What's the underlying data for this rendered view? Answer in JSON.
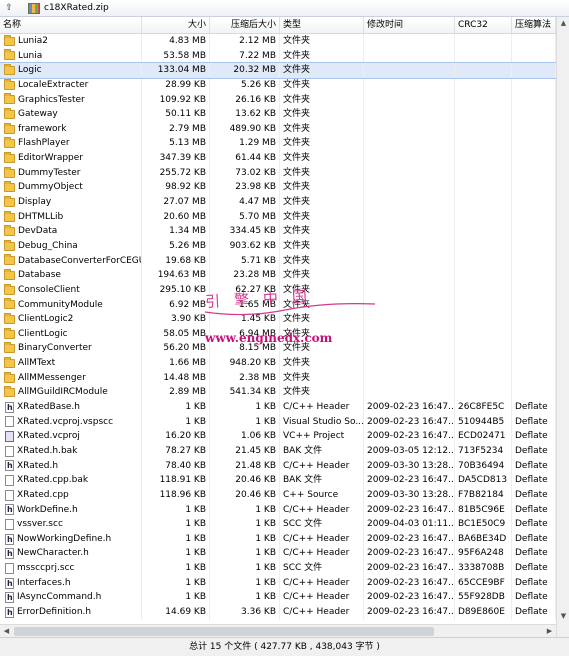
{
  "window": {
    "title": "c18XRated.zip"
  },
  "columns": [
    {
      "label": "名称",
      "w": 142
    },
    {
      "label": "大小",
      "w": 68,
      "align": "r"
    },
    {
      "label": "压缩后大小",
      "w": 70,
      "align": "r"
    },
    {
      "label": "类型",
      "w": 84
    },
    {
      "label": "修改时间",
      "w": 91
    },
    {
      "label": "CRC32",
      "w": 57
    },
    {
      "label": "压缩算法",
      "w": 44
    }
  ],
  "rows": [
    {
      "name": "Lunia2",
      "size": "4.83 MB",
      "packed": "2.12 MB",
      "type": "文件夹",
      "mtime": "",
      "crc": "",
      "method": "",
      "icon": "folder"
    },
    {
      "name": "Lunia",
      "size": "53.58 MB",
      "packed": "7.22 MB",
      "type": "文件夹",
      "mtime": "",
      "crc": "",
      "method": "",
      "icon": "folder"
    },
    {
      "name": "Logic",
      "size": "133.04 MB",
      "packed": "20.32 MB",
      "type": "文件夹",
      "mtime": "",
      "crc": "",
      "method": "",
      "icon": "folder",
      "selected": true
    },
    {
      "name": "LocaleExtracter",
      "size": "28.99 KB",
      "packed": "5.26 KB",
      "type": "文件夹",
      "mtime": "",
      "crc": "",
      "method": "",
      "icon": "folder"
    },
    {
      "name": "GraphicsTester",
      "size": "109.92 KB",
      "packed": "26.16 KB",
      "type": "文件夹",
      "mtime": "",
      "crc": "",
      "method": "",
      "icon": "folder"
    },
    {
      "name": "Gateway",
      "size": "50.11 KB",
      "packed": "13.62 KB",
      "type": "文件夹",
      "mtime": "",
      "crc": "",
      "method": "",
      "icon": "folder"
    },
    {
      "name": "framework",
      "size": "2.79 MB",
      "packed": "489.90 KB",
      "type": "文件夹",
      "mtime": "",
      "crc": "",
      "method": "",
      "icon": "folder"
    },
    {
      "name": "FlashPlayer",
      "size": "5.13 MB",
      "packed": "1.29 MB",
      "type": "文件夹",
      "mtime": "",
      "crc": "",
      "method": "",
      "icon": "folder"
    },
    {
      "name": "EditorWrapper",
      "size": "347.39 KB",
      "packed": "61.44 KB",
      "type": "文件夹",
      "mtime": "",
      "crc": "",
      "method": "",
      "icon": "folder"
    },
    {
      "name": "DummyTester",
      "size": "255.72 KB",
      "packed": "73.02 KB",
      "type": "文件夹",
      "mtime": "",
      "crc": "",
      "method": "",
      "icon": "folder"
    },
    {
      "name": "DummyObject",
      "size": "98.92 KB",
      "packed": "23.98 KB",
      "type": "文件夹",
      "mtime": "",
      "crc": "",
      "method": "",
      "icon": "folder"
    },
    {
      "name": "Display",
      "size": "27.07 MB",
      "packed": "4.47 MB",
      "type": "文件夹",
      "mtime": "",
      "crc": "",
      "method": "",
      "icon": "folder"
    },
    {
      "name": "DHTMLLib",
      "size": "20.60 MB",
      "packed": "5.70 MB",
      "type": "文件夹",
      "mtime": "",
      "crc": "",
      "method": "",
      "icon": "folder"
    },
    {
      "name": "DevData",
      "size": "1.34 MB",
      "packed": "334.45 KB",
      "type": "文件夹",
      "mtime": "",
      "crc": "",
      "method": "",
      "icon": "folder"
    },
    {
      "name": "Debug_China",
      "size": "5.26 MB",
      "packed": "903.62 KB",
      "type": "文件夹",
      "mtime": "",
      "crc": "",
      "method": "",
      "icon": "folder"
    },
    {
      "name": "DatabaseConverterForCEGUI",
      "size": "19.68 KB",
      "packed": "5.71 KB",
      "type": "文件夹",
      "mtime": "",
      "crc": "",
      "method": "",
      "icon": "folder"
    },
    {
      "name": "Database",
      "size": "194.63 MB",
      "packed": "23.28 MB",
      "type": "文件夹",
      "mtime": "",
      "crc": "",
      "method": "",
      "icon": "folder"
    },
    {
      "name": "ConsoleClient",
      "size": "295.10 KB",
      "packed": "62.27 KB",
      "type": "文件夹",
      "mtime": "",
      "crc": "",
      "method": "",
      "icon": "folder"
    },
    {
      "name": "CommunityModule",
      "size": "6.92 MB",
      "packed": "1.65 MB",
      "type": "文件夹",
      "mtime": "",
      "crc": "",
      "method": "",
      "icon": "folder"
    },
    {
      "name": "ClientLogic2",
      "size": "3.90 KB",
      "packed": "1.45 KB",
      "type": "文件夹",
      "mtime": "",
      "crc": "",
      "method": "",
      "icon": "folder"
    },
    {
      "name": "ClientLogic",
      "size": "58.05 MB",
      "packed": "6.94 MB",
      "type": "文件夹",
      "mtime": "",
      "crc": "",
      "method": "",
      "icon": "folder"
    },
    {
      "name": "BinaryConverter",
      "size": "56.20 MB",
      "packed": "8.15 MB",
      "type": "文件夹",
      "mtime": "",
      "crc": "",
      "method": "",
      "icon": "folder"
    },
    {
      "name": "AllMText",
      "size": "1.66 MB",
      "packed": "948.20 KB",
      "type": "文件夹",
      "mtime": "",
      "crc": "",
      "method": "",
      "icon": "folder"
    },
    {
      "name": "AllMMessenger",
      "size": "14.48 MB",
      "packed": "2.38 MB",
      "type": "文件夹",
      "mtime": "",
      "crc": "",
      "method": "",
      "icon": "folder"
    },
    {
      "name": "AllMGuildIRCModule",
      "size": "2.89 MB",
      "packed": "541.34 KB",
      "type": "文件夹",
      "mtime": "",
      "crc": "",
      "method": "",
      "icon": "folder"
    },
    {
      "name": "XRatedBase.h",
      "size": "1 KB",
      "packed": "1 KB",
      "type": "C/C++ Header",
      "mtime": "2009-02-23 16:47...",
      "crc": "26C8FE5C",
      "method": "Deflate",
      "icon": "h"
    },
    {
      "name": "XRated.vcproj.vspscc",
      "size": "1 KB",
      "packed": "1 KB",
      "type": "Visual Studio So...",
      "mtime": "2009-02-23 16:47...",
      "crc": "510944B5",
      "method": "Deflate",
      "icon": "file"
    },
    {
      "name": "XRated.vcproj",
      "size": "16.20 KB",
      "packed": "1.06 KB",
      "type": "VC++ Project",
      "mtime": "2009-02-23 16:47...",
      "crc": "ECD02471",
      "method": "Deflate",
      "icon": "vc"
    },
    {
      "name": "XRated.h.bak",
      "size": "78.27 KB",
      "packed": "21.45 KB",
      "type": "BAK 文件",
      "mtime": "2009-03-05 12:12...",
      "crc": "713F5234",
      "method": "Deflate",
      "icon": "file"
    },
    {
      "name": "XRated.h",
      "size": "78.40 KB",
      "packed": "21.48 KB",
      "type": "C/C++ Header",
      "mtime": "2009-03-30 13:28...",
      "crc": "70B36494",
      "method": "Deflate",
      "icon": "h"
    },
    {
      "name": "XRated.cpp.bak",
      "size": "118.91 KB",
      "packed": "20.46 KB",
      "type": "BAK 文件",
      "mtime": "2009-02-23 16:47...",
      "crc": "DA5CD813",
      "method": "Deflate",
      "icon": "file"
    },
    {
      "name": "XRated.cpp",
      "size": "118.96 KB",
      "packed": "20.46 KB",
      "type": "C++ Source",
      "mtime": "2009-03-30 13:28...",
      "crc": "F7B82184",
      "method": "Deflate",
      "icon": "file"
    },
    {
      "name": "WorkDefine.h",
      "size": "1 KB",
      "packed": "1 KB",
      "type": "C/C++ Header",
      "mtime": "2009-02-23 16:47...",
      "crc": "81B5C96E",
      "method": "Deflate",
      "icon": "h"
    },
    {
      "name": "vssver.scc",
      "size": "1 KB",
      "packed": "1 KB",
      "type": "SCC 文件",
      "mtime": "2009-04-03 01:11...",
      "crc": "BC1E50C9",
      "method": "Deflate",
      "icon": "file"
    },
    {
      "name": "NowWorkingDefine.h",
      "size": "1 KB",
      "packed": "1 KB",
      "type": "C/C++ Header",
      "mtime": "2009-02-23 16:47...",
      "crc": "BA6BE34D",
      "method": "Deflate",
      "icon": "h"
    },
    {
      "name": "NewCharacter.h",
      "size": "1 KB",
      "packed": "1 KB",
      "type": "C/C++ Header",
      "mtime": "2009-02-23 16:47...",
      "crc": "95F6A248",
      "method": "Deflate",
      "icon": "h"
    },
    {
      "name": "mssccprj.scc",
      "size": "1 KB",
      "packed": "1 KB",
      "type": "SCC 文件",
      "mtime": "2009-02-23 16:47...",
      "crc": "3338708B",
      "method": "Deflate",
      "icon": "file"
    },
    {
      "name": "Interfaces.h",
      "size": "1 KB",
      "packed": "1 KB",
      "type": "C/C++ Header",
      "mtime": "2009-02-23 16:47...",
      "crc": "65CCE9BF",
      "method": "Deflate",
      "icon": "h"
    },
    {
      "name": "IAsyncCommand.h",
      "size": "1 KB",
      "packed": "1 KB",
      "type": "C/C++ Header",
      "mtime": "2009-02-23 16:47...",
      "crc": "55F928DB",
      "method": "Deflate",
      "icon": "h"
    },
    {
      "name": "ErrorDefinition.h",
      "size": "14.69 KB",
      "packed": "3.36 KB",
      "type": "C/C++ Header",
      "mtime": "2009-02-23 16:47...",
      "crc": "D89E860E",
      "method": "Deflate",
      "icon": "h"
    }
  ],
  "status": {
    "text": "总计 15 个文件 ( 427.77 KB , 438,043 字节 )"
  },
  "watermark": {
    "cn": "引擎中国",
    "url": "www.enginedx.com"
  }
}
